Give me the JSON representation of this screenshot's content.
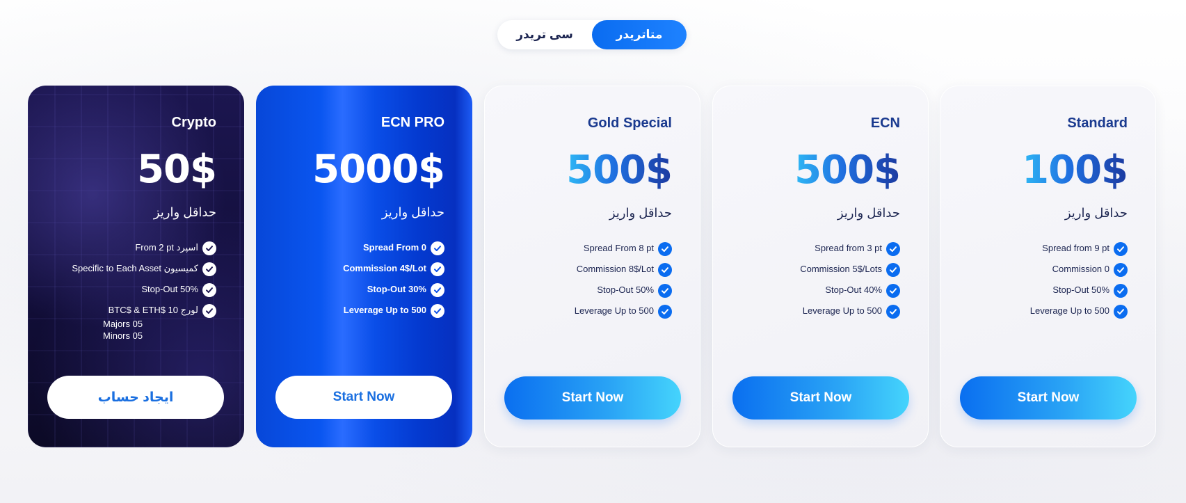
{
  "toggle": {
    "options": [
      {
        "label": "سی تریدر",
        "active": false
      },
      {
        "label": "متاتریدر",
        "active": true
      }
    ]
  },
  "cards": [
    {
      "title": "Crypto",
      "price": "50$",
      "subtitle": "حداقل واریز",
      "features": [
        "From 2 pt اسپرد",
        "Specific to Each Asset کمیسیون",
        "Stop-Out 50%",
        "BTC$ & ETH$ 10 لورج"
      ],
      "extra_lines": [
        "Majors 05",
        "Minors 05"
      ],
      "cta": "ایجاد حساب"
    },
    {
      "title": "ECN PRO",
      "price": "5000$",
      "subtitle": "حداقل واریز",
      "features": [
        "Spread From 0",
        "Commission 4$/Lot",
        "Stop-Out 30%",
        "Leverage Up to 500"
      ],
      "cta": "Start Now"
    },
    {
      "title": "Gold Special",
      "price": "500$",
      "subtitle": "حداقل واریز",
      "features": [
        "Spread From 8 pt",
        "Commission 8$/Lot",
        "Stop-Out 50%",
        "Leverage Up to 500"
      ],
      "cta": "Start Now"
    },
    {
      "title": "ECN",
      "price": "500$",
      "subtitle": "حداقل واریز",
      "features": [
        "Spread from 3 pt",
        "Commission 5$/Lots",
        "Stop-Out 40%",
        "Leverage Up to 500"
      ],
      "cta": "Start Now"
    },
    {
      "title": "Standard",
      "price": "100$",
      "subtitle": "حداقل واریز",
      "features": [
        "Spread from 9 pt",
        "Commission 0",
        "Stop-Out 50%",
        "Leverage Up to 500"
      ],
      "cta": "Start Now"
    }
  ],
  "icons": {
    "check": "check-circle-icon"
  },
  "colors": {
    "accent": "#0a6cf0",
    "crypto_bg": "#1c1650",
    "ecnpro_bg": "#0a56f0",
    "text_dark": "#1b2450"
  }
}
